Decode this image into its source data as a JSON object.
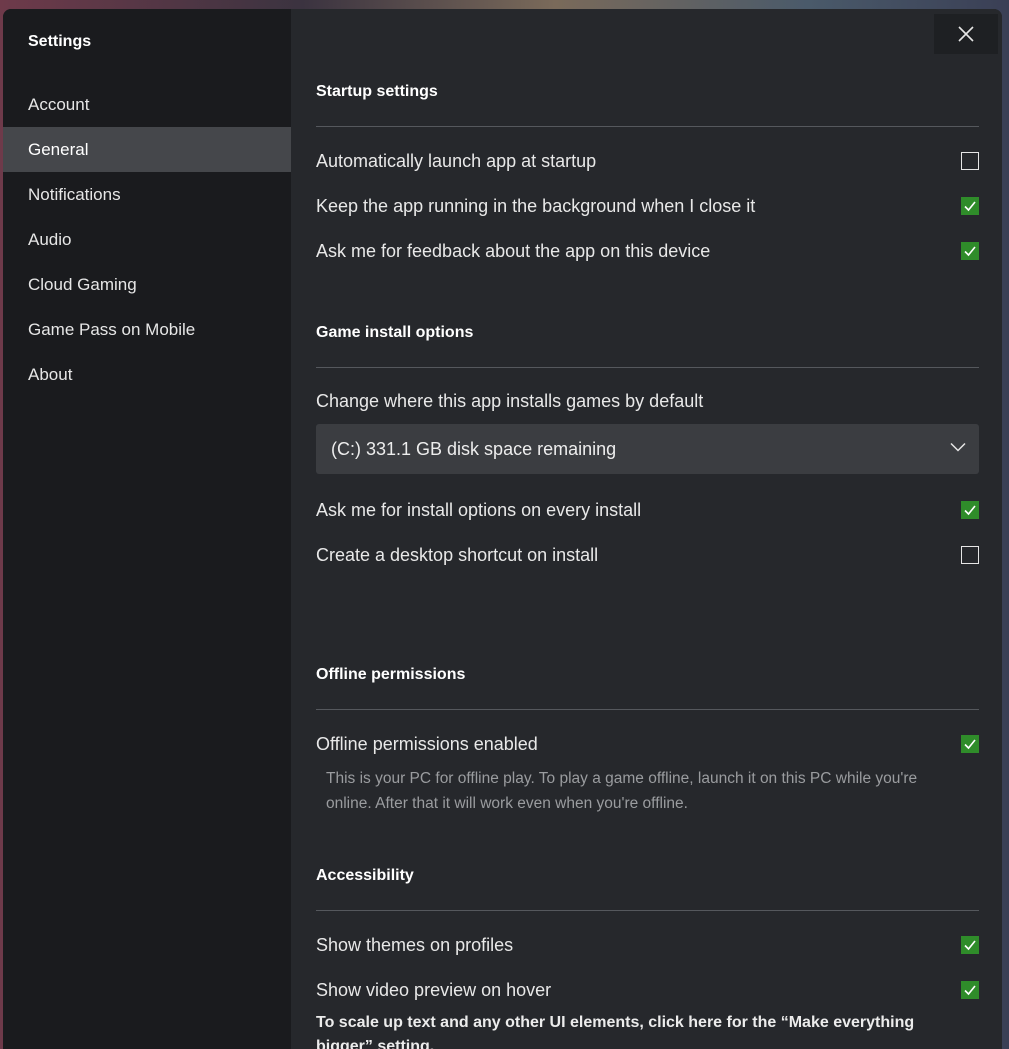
{
  "window": {
    "title": "Settings"
  },
  "sidebar": {
    "items": [
      {
        "label": "Account",
        "active": false
      },
      {
        "label": "General",
        "active": true
      },
      {
        "label": "Notifications",
        "active": false
      },
      {
        "label": "Audio",
        "active": false
      },
      {
        "label": "Cloud Gaming",
        "active": false
      },
      {
        "label": "Game Pass on Mobile",
        "active": false
      },
      {
        "label": "About",
        "active": false
      }
    ]
  },
  "startup": {
    "title": "Startup settings",
    "options": [
      {
        "label": "Automatically launch app at startup",
        "checked": false
      },
      {
        "label": "Keep the app running in the background when I close it",
        "checked": true
      },
      {
        "label": "Ask me for feedback about the app on this device",
        "checked": true
      }
    ]
  },
  "install": {
    "title": "Game install options",
    "location_label": "Change where this app installs games by default",
    "location_value": "(C:) 331.1 GB disk space remaining",
    "options": [
      {
        "label": "Ask me for install options on every install",
        "checked": true
      },
      {
        "label": "Create a desktop shortcut on install",
        "checked": false
      }
    ]
  },
  "offline": {
    "title": "Offline permissions",
    "option": {
      "label": "Offline permissions enabled",
      "checked": true
    },
    "description": "This is your PC for offline play. To play a game offline, launch it on this PC while you're online. After that it will work even when you're offline."
  },
  "accessibility": {
    "title": "Accessibility",
    "options": [
      {
        "label": "Show themes on profiles",
        "checked": true
      },
      {
        "label": "Show video preview on hover",
        "checked": true
      }
    ],
    "scale_link": "To scale up text and any other UI elements, click here for the “Make everything bigger” setting."
  },
  "colors": {
    "accent": "#2f8c2a",
    "sidebar_active": "#45474b"
  }
}
